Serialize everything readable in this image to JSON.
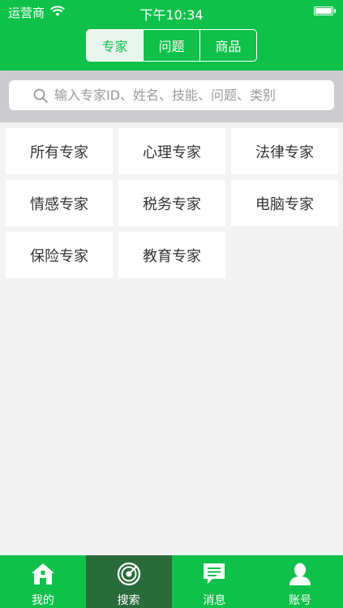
{
  "status_bar": {
    "carrier": "运营商",
    "time": "下午10:34"
  },
  "segments": [
    {
      "label": "专家",
      "active": true
    },
    {
      "label": "问题",
      "active": false
    },
    {
      "label": "商品",
      "active": false
    }
  ],
  "search": {
    "placeholder": "输入专家ID、姓名、技能、问题、类别"
  },
  "categories": [
    "所有专家",
    "心理专家",
    "法律专家",
    "情感专家",
    "税务专家",
    "电脑专家",
    "保险专家",
    "教育专家"
  ],
  "tabbar": [
    {
      "label": "我的",
      "icon": "home-icon",
      "active": false
    },
    {
      "label": "搜索",
      "icon": "radar-icon",
      "active": true
    },
    {
      "label": "消息",
      "icon": "chat-icon",
      "active": false
    },
    {
      "label": "账号",
      "icon": "user-icon",
      "active": false
    }
  ],
  "colors": {
    "brand_green": "#0fc14a",
    "active_tab": "#2a6b3c",
    "search_band": "#cbcbd0",
    "background": "#f3f3f3"
  }
}
